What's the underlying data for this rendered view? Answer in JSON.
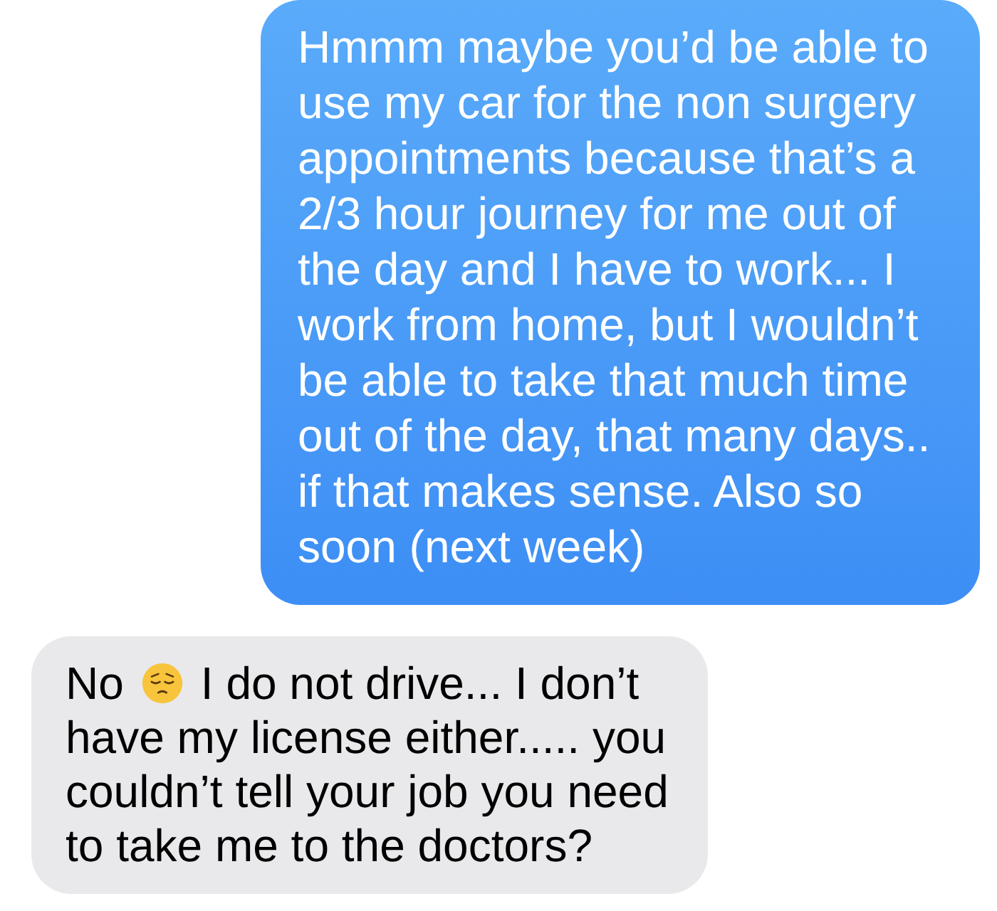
{
  "messages": [
    {
      "kind": "sent",
      "text": "Hmmm maybe you’d be able to use my car for the non surgery appointments because that’s a 2/3 hour journey for me out of the day and I have to work... I work from home, but I wouldn’t be able to take that much time out of the day, that many days.. if that makes sense. Also so soon (next week)"
    },
    {
      "kind": "received",
      "lead": "No",
      "text": "I do not drive... I don’t",
      "more": "have my license either..... you couldn’t tell your job you need to take me to the doctors?"
    }
  ]
}
